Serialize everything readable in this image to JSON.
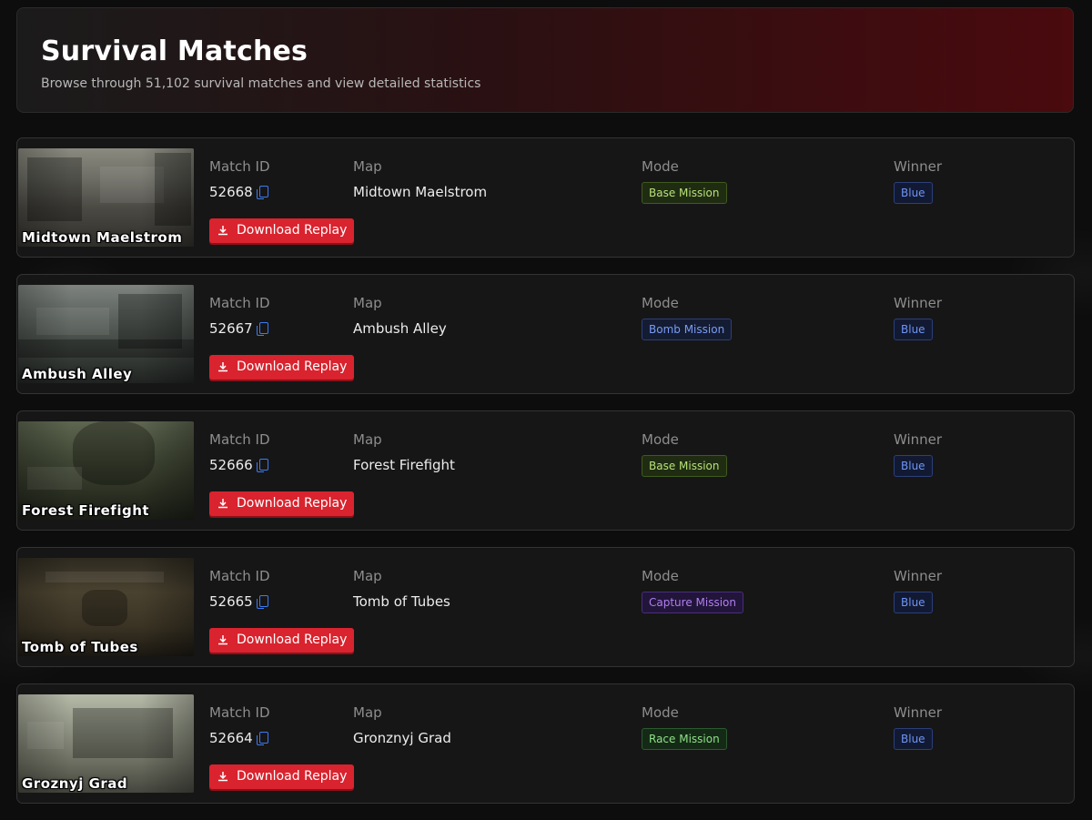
{
  "header": {
    "title": "Survival Matches",
    "subtitle": "Browse through 51,102 survival matches and view detailed statistics"
  },
  "labels": {
    "match_id": "Match ID",
    "map": "Map",
    "mode": "Mode",
    "winner": "Winner",
    "download": "Download Replay"
  },
  "matches": [
    {
      "id": "52668",
      "map": "Midtown Maelstrom",
      "thumb_title": "Midtown Maelstrom",
      "mode": "Base Mission",
      "winner": "Blue"
    },
    {
      "id": "52667",
      "map": "Ambush Alley",
      "thumb_title": "Ambush Alley",
      "mode": "Bomb Mission",
      "winner": "Blue"
    },
    {
      "id": "52666",
      "map": "Forest Firefight",
      "thumb_title": "Forest Firefight",
      "mode": "Base Mission",
      "winner": "Blue"
    },
    {
      "id": "52665",
      "map": "Tomb of Tubes",
      "thumb_title": "Tomb of Tubes",
      "mode": "Capture Mission",
      "winner": "Blue"
    },
    {
      "id": "52664",
      "map": "Gronznyj Grad",
      "thumb_title": "Groznyj Grad",
      "mode": "Race Mission",
      "winner": "Blue"
    }
  ]
}
